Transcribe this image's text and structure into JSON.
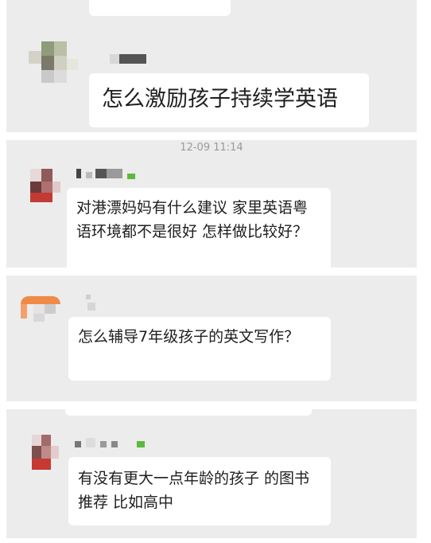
{
  "messages": [
    {
      "text": "怎么激励孩子持续学英语"
    },
    {
      "text": "对港漂妈妈有什么建议 家里英语粤语环境都不是很好 怎样做比较好？"
    },
    {
      "text": "怎么辅导7年级孩子的英文写作？"
    },
    {
      "text": "有没有更大一点年龄的孩子 的图书推荐 比如高中"
    }
  ],
  "timestamp": "12-09 11:14",
  "colors": {
    "panel_bg": "#ececec",
    "bubble_bg": "#ffffff",
    "text": "#1e1e1e",
    "timestamp": "#9a9a9a",
    "badge": "#5dba3b"
  }
}
